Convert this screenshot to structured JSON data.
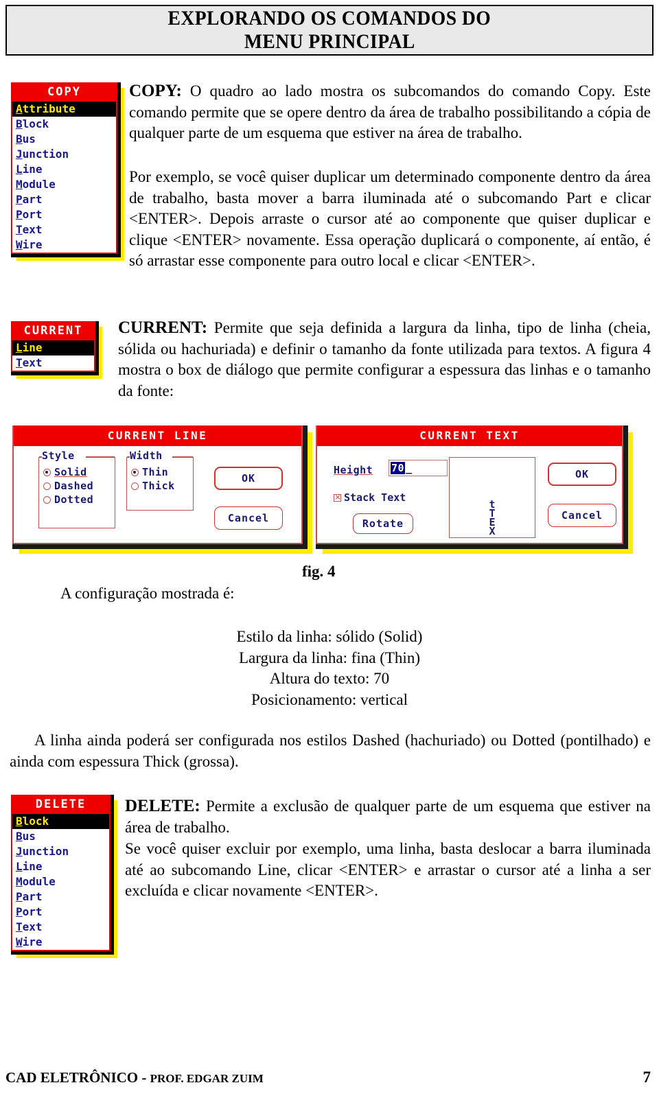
{
  "header": {
    "line1": "EXPLORANDO OS COMANDOS DO",
    "line2": "MENU PRINCIPAL"
  },
  "copy_menu": {
    "title": "COPY",
    "items": [
      {
        "accel": "A",
        "rest": "ttribute",
        "selected": true
      },
      {
        "accel": "B",
        "rest": "lock",
        "selected": false
      },
      {
        "accel": "B",
        "rest": "us",
        "selected": false
      },
      {
        "accel": "J",
        "rest": "unction",
        "selected": false
      },
      {
        "accel": "L",
        "rest": "ine",
        "selected": false
      },
      {
        "accel": "M",
        "rest": "odule",
        "selected": false
      },
      {
        "accel": "P",
        "rest": "art",
        "selected": false
      },
      {
        "accel": "P",
        "rest": "ort",
        "selected": false
      },
      {
        "accel": "T",
        "rest": "ext",
        "selected": false
      },
      {
        "accel": "W",
        "rest": "ire",
        "selected": false
      }
    ]
  },
  "copy_text": {
    "lead": "COPY:",
    "body": " O quadro ao lado mostra os subcomandos do comando Copy. Este comando permite que se opere dentro da área de trabalho possibilitando a cópia de qualquer parte de um esquema que estiver na área de trabalho.",
    "body2": "Por exemplo, se você quiser duplicar um determinado componente dentro da área de trabalho, basta mover a barra iluminada até o subcomando Part e clicar <ENTER>. Depois arraste o cursor até ao componente que quiser duplicar e clique <ENTER> novamente. Essa operação duplicará o componente, aí então, é só arrastar esse componente para outro local e clicar <ENTER>."
  },
  "current_menu": {
    "title": "CURRENT",
    "items": [
      {
        "accel": "L",
        "rest": "ine",
        "selected": true
      },
      {
        "accel": "T",
        "rest": "ext",
        "selected": false
      }
    ]
  },
  "current_text": {
    "lead": "CURRENT:",
    "body": " Permite que seja definida a largura da linha, tipo de linha (cheia, sólida ou hachuriada) e definir o tamanho da fonte utilizada para textos. A figura 4 mostra o box de diálogo que permite configurar a espessura das linhas e o tamanho da fonte:"
  },
  "dialog_line": {
    "title": "CURRENT LINE",
    "style_legend": "Style",
    "style_options": [
      {
        "label": "Solid",
        "selected": true
      },
      {
        "label": "Dashed",
        "selected": false
      },
      {
        "label": "Dotted",
        "selected": false
      }
    ],
    "width_legend": "Width",
    "width_options": [
      {
        "label": "Thin",
        "selected": true
      },
      {
        "label": "Thick",
        "selected": false
      }
    ],
    "ok_label": "OK",
    "cancel_label": "Cancel"
  },
  "dialog_text": {
    "title": "CURRENT TEXT",
    "height_label": "Height",
    "height_value": "70",
    "caret": "_",
    "stack_label": "Stack Text",
    "stack_checked": true,
    "rotate_label": "Rotate",
    "preview_chars": [
      "t",
      "T",
      "E",
      "X"
    ],
    "ok_label": "OK",
    "cancel_label": "Cancel"
  },
  "figure": {
    "caption": "fig. 4",
    "config_intro": "A configuração mostrada é:",
    "config_lines": [
      "Estilo da linha: sólido (Solid)",
      "Largura da linha: fina (Thin)",
      "Altura do texto: 70",
      "Posicionamento: vertical"
    ]
  },
  "note_paragraph": "A linha ainda poderá ser configurada nos estilos Dashed (hachuriado) ou Dotted (pontilhado) e ainda com espessura Thick (grossa).",
  "delete_menu": {
    "title": "DELETE",
    "items": [
      {
        "accel": "B",
        "rest": "lock",
        "selected": true
      },
      {
        "accel": "B",
        "rest": "us",
        "selected": false
      },
      {
        "accel": "J",
        "rest": "unction",
        "selected": false
      },
      {
        "accel": "L",
        "rest": "ine",
        "selected": false
      },
      {
        "accel": "M",
        "rest": "odule",
        "selected": false
      },
      {
        "accel": "P",
        "rest": "art",
        "selected": false
      },
      {
        "accel": "P",
        "rest": "ort",
        "selected": false
      },
      {
        "accel": "T",
        "rest": "ext",
        "selected": false
      },
      {
        "accel": "W",
        "rest": "ire",
        "selected": false
      }
    ]
  },
  "delete_text": {
    "lead": "DELETE:",
    "body": " Permite a exclusão de qualquer parte de um esquema que estiver na área de trabalho.",
    "body2": "Se você quiser excluir por exemplo, uma linha, basta deslocar a barra iluminada até ao subcomando Line, clicar <ENTER> e arrastar o cursor até a linha a ser excluída e clicar novamente <ENTER>."
  },
  "footer": {
    "brand": "CAD ELETRÔNICO",
    "separator": " - ",
    "author": "PROF. EDGAR ZUIM",
    "page": "7"
  },
  "colors": {
    "title_red": "#ee0000",
    "menu_blue": "#1a1a8c",
    "highlight_yellow": "#ffe500",
    "shadow_yellow": "#ffea00",
    "dialog_border": "#c0504d",
    "select_navy": "#000080"
  }
}
